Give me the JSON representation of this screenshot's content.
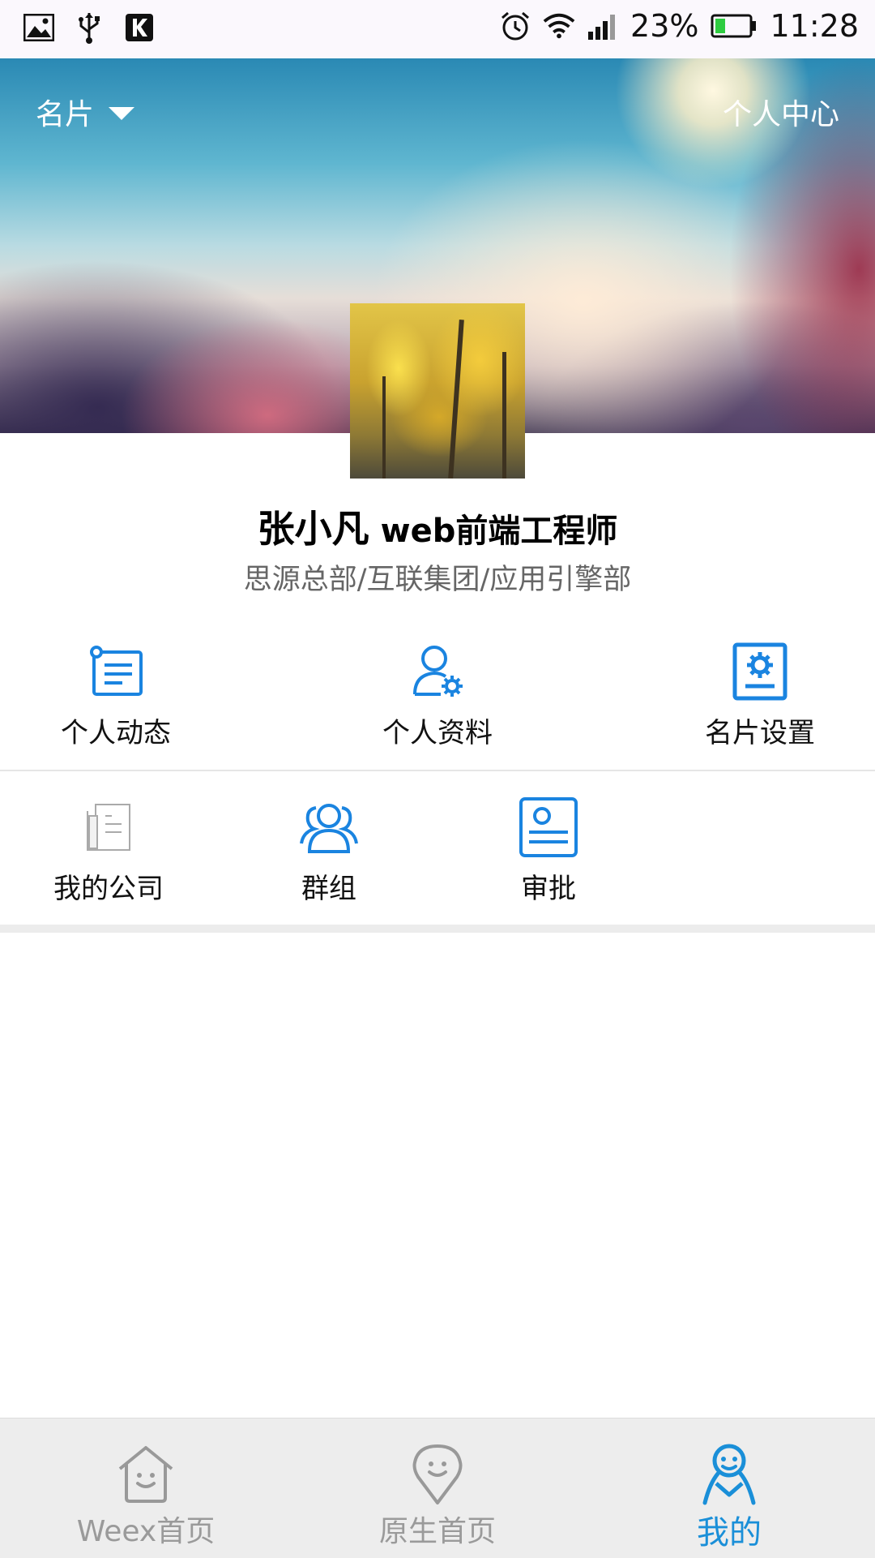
{
  "status_bar": {
    "battery": "23%",
    "time": "11:28",
    "left_icons": [
      "image-icon",
      "usb-icon",
      "k-app-icon"
    ],
    "right_icons": [
      "alarm-icon",
      "wifi-icon",
      "signal-icon",
      "battery-icon"
    ]
  },
  "header": {
    "title": "名片",
    "right_link": "个人中心"
  },
  "profile": {
    "name": "张小凡",
    "position": "web前端工程师",
    "org": "思源总部/互联集团/应用引擎部"
  },
  "menu_row1": [
    {
      "label": "个人动态",
      "icon": "activity-list-icon"
    },
    {
      "label": "个人资料",
      "icon": "user-settings-icon"
    },
    {
      "label": "名片设置",
      "icon": "card-settings-icon"
    }
  ],
  "menu_row2": [
    {
      "label": "我的公司",
      "icon": "company-icon"
    },
    {
      "label": "群组",
      "icon": "group-icon"
    },
    {
      "label": "审批",
      "icon": "approval-icon"
    }
  ],
  "tabbar": {
    "tabs": [
      {
        "label": "Weex首页",
        "icon": "home-face-icon",
        "active": false
      },
      {
        "label": "原生首页",
        "icon": "location-face-icon",
        "active": false
      },
      {
        "label": "我的",
        "icon": "person-icon",
        "active": true
      }
    ]
  },
  "colors": {
    "accent": "#1a8fd8",
    "icon_blue": "#1a84e0",
    "inactive": "#9a9a9a"
  }
}
